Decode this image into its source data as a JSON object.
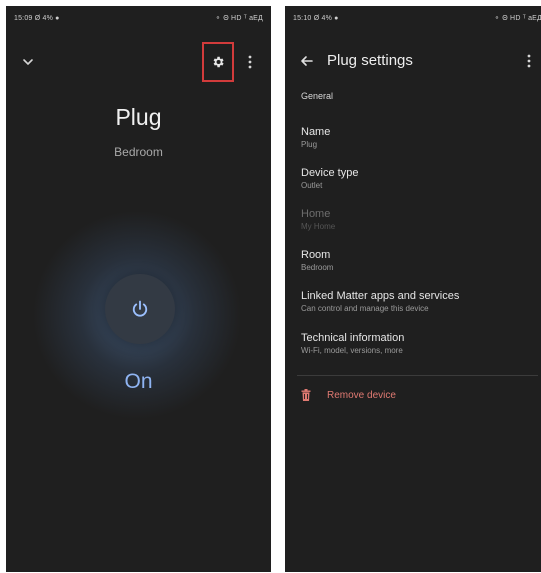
{
  "left_screen": {
    "status_bar": {
      "time": "15:09",
      "left_icons": "Ø 4% ●",
      "right_icons": "⚬ Θ HD ᵀ аЕД"
    },
    "device_name": "Plug",
    "room": "Bedroom",
    "power_state": "On",
    "icons": {
      "collapse": "chevron-down-icon",
      "settings": "gear-icon",
      "more": "more-vert-icon",
      "power": "power-icon"
    },
    "colors": {
      "highlight": "#d23b3b",
      "on_accent": "#8fb4f2"
    }
  },
  "right_screen": {
    "status_bar": {
      "time": "15:10",
      "left_icons": "Ø 4% ●",
      "right_icons": "⚬ Θ HD ᵀ аЕД"
    },
    "title": "Plug settings",
    "section": "General",
    "items": [
      {
        "title": "Name",
        "subtitle": "Plug",
        "enabled": true
      },
      {
        "title": "Device type",
        "subtitle": "Outlet",
        "enabled": true
      },
      {
        "title": "Home",
        "subtitle": "My Home",
        "enabled": false
      },
      {
        "title": "Room",
        "subtitle": "Bedroom",
        "enabled": true
      },
      {
        "title": "Linked Matter apps and services",
        "subtitle": "Can control and manage this device",
        "enabled": true
      },
      {
        "title": "Technical information",
        "subtitle": "Wi-Fi, model, versions, more",
        "enabled": true
      }
    ],
    "remove_label": "Remove device",
    "icons": {
      "back": "arrow-back-icon",
      "more": "more-vert-icon",
      "remove": "trash-icon"
    },
    "colors": {
      "danger": "#e07a72"
    }
  }
}
